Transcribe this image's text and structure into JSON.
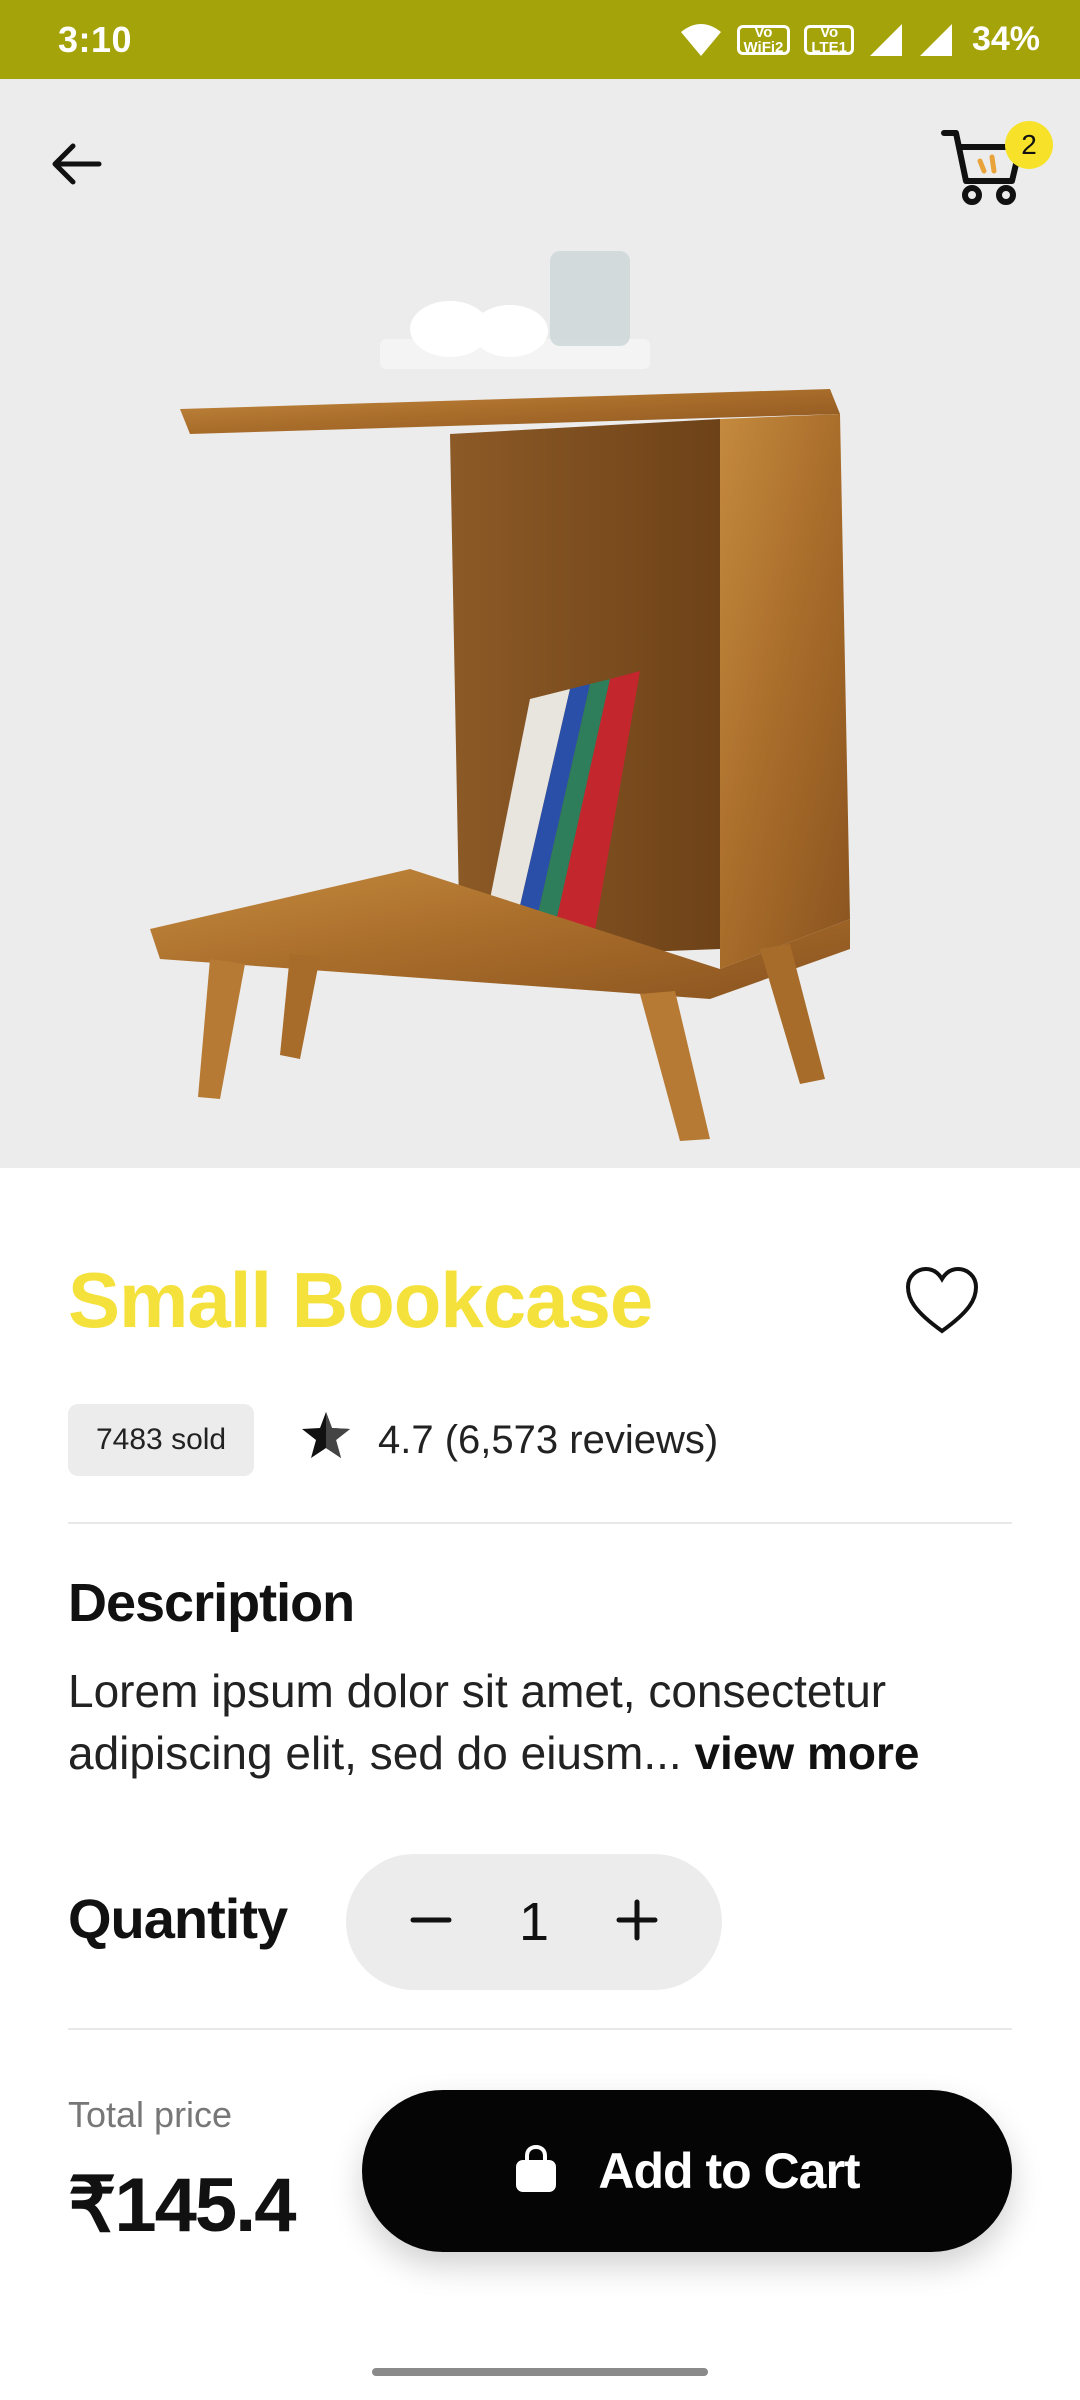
{
  "status_bar": {
    "time": "3:10",
    "wifi_badge_line1": "Vo",
    "wifi_badge_line2": "WiFi2",
    "lte_badge_line1": "Vo",
    "lte_badge_line2": "LTE1",
    "battery": "34%"
  },
  "header": {
    "cart_count": "2"
  },
  "product": {
    "name": "Small Bookcase",
    "sold": "7483 sold",
    "rating": "4.7 (6,573 reviews)",
    "favorite": false
  },
  "description": {
    "title": "Description",
    "text": "Lorem ipsum dolor sit amet, consectetur adipiscing elit, sed do eiusm... ",
    "view_more": "view more"
  },
  "quantity": {
    "label": "Quantity",
    "value": "1"
  },
  "footer": {
    "total_label": "Total price",
    "total_value": "₹145.4",
    "add_to_cart_label": "Add to Cart"
  },
  "colors": {
    "status_bar": "#a5a30a",
    "accent_yellow": "#f5e13b",
    "button_black": "#050505",
    "hero_bg": "#ececec"
  },
  "icons": [
    "wifi-icon",
    "signal-icon",
    "back-arrow-icon",
    "cart-icon",
    "heart-icon",
    "star-icon",
    "minus-icon",
    "plus-icon",
    "bag-icon"
  ]
}
